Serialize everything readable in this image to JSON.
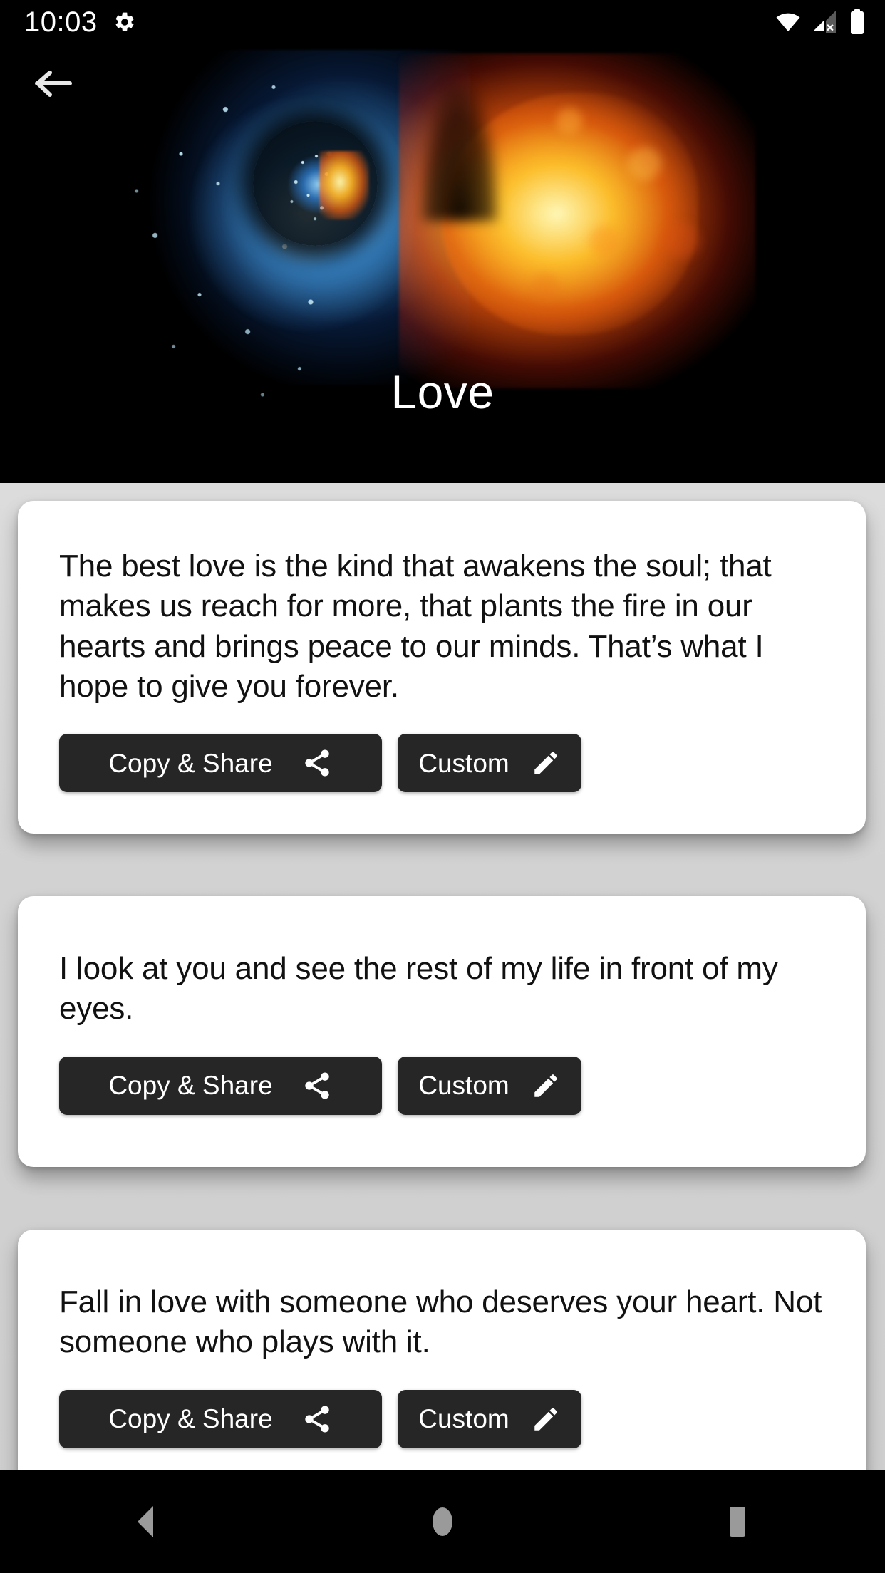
{
  "status_bar": {
    "time": "10:03",
    "icons": {
      "settings": "gear-icon",
      "wifi": "wifi-icon",
      "signal": "cellular-signal-off-icon",
      "battery": "battery-full-icon"
    }
  },
  "hero": {
    "title": "Love",
    "back_icon": "back-arrow-icon",
    "art": "fire-and-water-heart-image",
    "colors": {
      "background": "#000000",
      "water": "#3c96e6",
      "fire": "#ff9c1e",
      "title_color": "#ffffff"
    }
  },
  "theme": {
    "page_background": "#d6d6d6",
    "card_background": "#ffffff",
    "button_background": "#262626",
    "button_text": "#ffffff",
    "quote_text": "#111111"
  },
  "cards": [
    {
      "quote": "The best love is the kind that awakens the soul; that makes us reach for more, that plants the fire in our hearts and brings peace to our minds. That’s what I hope to give you forever.",
      "copy_label": "Copy & Share",
      "custom_label": "Custom",
      "share_icon": "share-icon",
      "edit_icon": "pencil-icon"
    },
    {
      "quote": "I look at you and see the rest of my life in front of my eyes.",
      "copy_label": "Copy & Share",
      "custom_label": "Custom",
      "share_icon": "share-icon",
      "edit_icon": "pencil-icon"
    },
    {
      "quote": "Fall in love with someone who deserves your heart. Not someone who plays with it.",
      "copy_label": "Copy & Share",
      "custom_label": "Custom",
      "share_icon": "share-icon",
      "edit_icon": "pencil-icon"
    }
  ],
  "nav_bar": {
    "back": "nav-back-triangle-icon",
    "home": "nav-home-circle-icon",
    "recents": "nav-recents-square-icon",
    "color": "#9a9a9a"
  }
}
